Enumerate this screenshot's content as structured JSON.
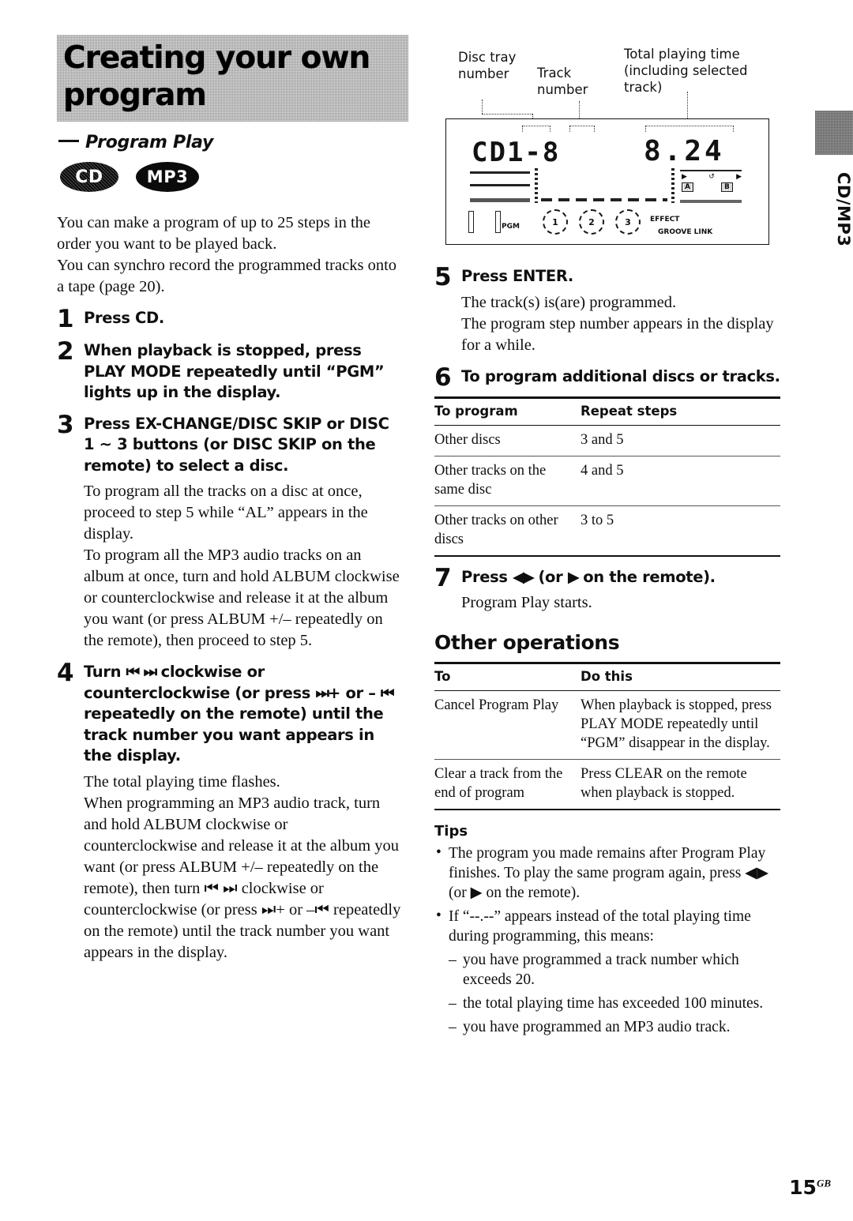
{
  "chapter": {
    "title_line1": "Creating your own",
    "title_line2": "program",
    "subtitle": "Program Play",
    "badges": [
      {
        "name": "cd-badge",
        "label": "CD"
      },
      {
        "name": "mp3-badge",
        "label": "MP3"
      }
    ]
  },
  "intro": {
    "p1": "You can make a program of up to 25 steps in the order you want to be played back.",
    "p2": "You can synchro record the programmed tracks onto a tape (page 20)."
  },
  "steps_left": [
    {
      "num": "1",
      "head": "Press CD.",
      "sub": []
    },
    {
      "num": "2",
      "head": "When playback is stopped, press PLAY MODE repeatedly until “PGM” lights up in the display.",
      "sub": []
    },
    {
      "num": "3",
      "head": "Press EX-CHANGE/DISC SKIP or DISC 1 ~ 3 buttons (or DISC SKIP on the remote) to select a disc.",
      "sub": [
        "To program all the tracks on a disc at once, proceed to step 5 while “AL” appears in the display.",
        "To program all the MP3 audio tracks on an album at once, turn and hold ALBUM clockwise or counterclockwise and release it at the album you want (or press ALBUM +/– repeatedly on the remote), then proceed to step 5."
      ]
    },
    {
      "num": "4",
      "head_part1": "Turn ",
      "head_icon1": "⏮",
      "head_part2": " ",
      "head_icon2": "⏭",
      "head_part3": " clockwise or counterclockwise (or press ",
      "head_icon3": "⏭",
      "head_part4": "+ or – ",
      "head_icon4": "⏮",
      "head_part5": " repeatedly on the remote) until the track number you want appears in the display.",
      "sub": [
        "The total playing time flashes.",
        "When programming an MP3 audio track, turn and hold ALBUM clockwise or counterclockwise and release it at the album you want (or press ALBUM +/– repeatedly on the remote), then turn ⏮ ⏭ clockwise or counterclockwise (or press ⏭+ or –⏮ repeatedly on the remote) until the track number you want appears in the display."
      ]
    }
  ],
  "diagram": {
    "callouts": [
      {
        "name": "callout-disc-tray-number",
        "text": "Disc tray number"
      },
      {
        "name": "callout-track-number",
        "text": "Track number"
      },
      {
        "name": "callout-total-playing-time",
        "text": "Total playing time (including selected track)"
      }
    ],
    "lcd": {
      "main_display": "CD1-8",
      "time_display": "8.24",
      "pgm_label": "PGM",
      "disc_icons": [
        "1",
        "2",
        "3"
      ],
      "effect_label": "EFFECT",
      "groove_label": "GROOVE LINK",
      "tape_a": "A",
      "tape_b": "B",
      "play_left": "▶",
      "loop": "↺",
      "play_right": "▶"
    }
  },
  "steps_right": [
    {
      "num": "5",
      "head": "Press ENTER.",
      "sub": [
        "The track(s) is(are) programmed.",
        "The program step number appears in the display for a while."
      ]
    },
    {
      "num": "6",
      "head": "To program additional discs or tracks.",
      "sub": []
    }
  ],
  "program_table": {
    "headers": [
      "To program",
      "Repeat steps"
    ],
    "rows": [
      [
        "Other discs",
        "3 and 5"
      ],
      [
        "Other tracks on the same disc",
        "4 and 5"
      ],
      [
        "Other tracks on other discs",
        "3 to 5"
      ]
    ]
  },
  "step7": {
    "num": "7",
    "head_part1": "Press ",
    "head_icon1": "◀▶",
    "head_part2": " (or ",
    "head_icon2": "▶",
    "head_part3": " on the remote).",
    "sub": "Program Play starts."
  },
  "other_operations": {
    "heading": "Other operations",
    "headers": [
      "To",
      "Do this"
    ],
    "rows": [
      [
        "Cancel Program Play",
        "When playback is stopped, press PLAY MODE repeatedly until “PGM” disappear in the display."
      ],
      [
        "Clear a track from the end of program",
        "Press CLEAR on the remote when playback is stopped."
      ]
    ]
  },
  "tips": {
    "heading": "Tips",
    "items": [
      "The program you made remains after Program Play finishes. To play the same program again, press ◀▶ (or ▶ on the remote).",
      "If “--.--” appears instead of the total playing time during programming, this means:"
    ],
    "subitems": [
      "you have programmed a track number which exceeds 20.",
      "the total playing time has exceeded 100 minutes.",
      "you have programmed an MP3 audio track."
    ]
  },
  "side_tab": {
    "label": "CD/MP3"
  },
  "folio": {
    "page": "15",
    "suffix": "GB"
  }
}
